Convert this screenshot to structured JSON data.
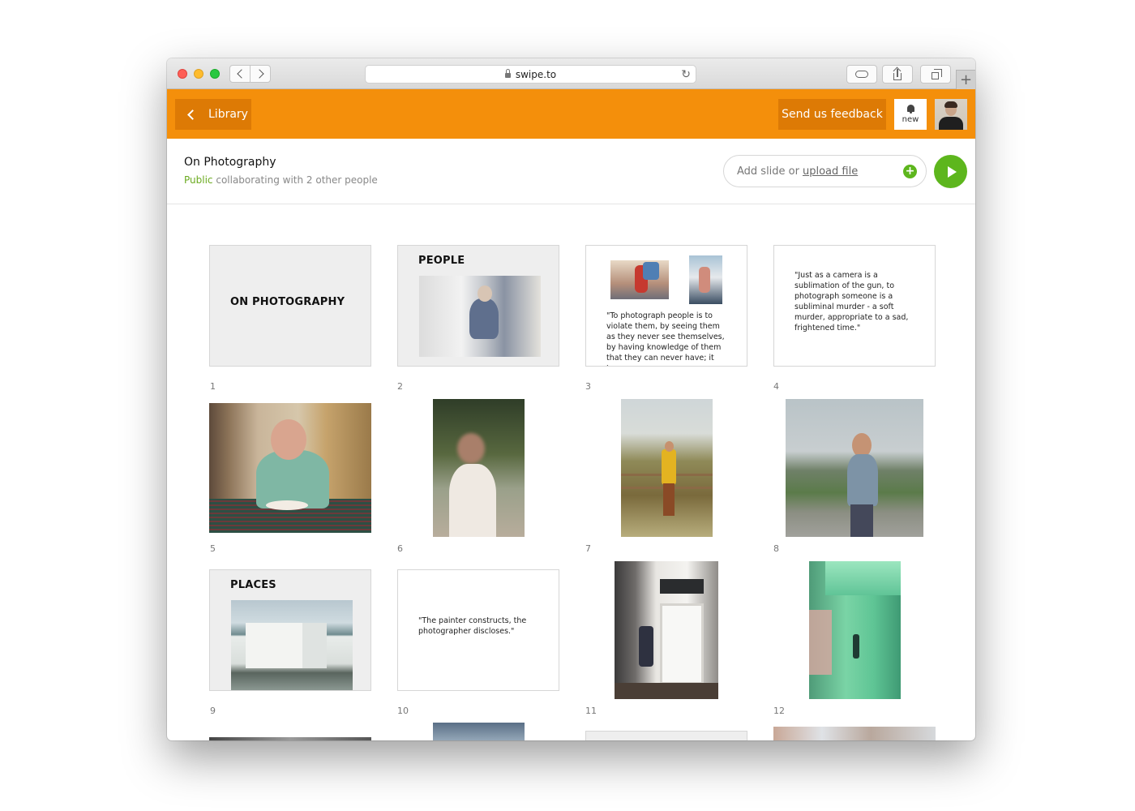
{
  "browser": {
    "url": "swipe.to"
  },
  "header": {
    "back_label": "Library",
    "feedback_label": "Send us feedback",
    "notifications_label": "new"
  },
  "deck": {
    "title": "On Photography",
    "visibility": "Public",
    "collab_text": "collaborating with 2 other people",
    "add_prefix": "Add slide or",
    "add_link": "upload file"
  },
  "slides": [
    {
      "number": "1",
      "title": "ON PHOTOGRAPHY"
    },
    {
      "number": "2",
      "title": "PEOPLE"
    },
    {
      "number": "3",
      "quote": "\"To photograph people is to violate them, by seeing them as they never see themselves, by having knowledge of them that they can never have; it turns"
    },
    {
      "number": "4",
      "quote": "\"Just as a camera is a sublimation of the gun, to photograph someone is a subliminal murder - a soft murder, appropriate to a sad, frightened time.\""
    },
    {
      "number": "5"
    },
    {
      "number": "6"
    },
    {
      "number": "7"
    },
    {
      "number": "8"
    },
    {
      "number": "9",
      "title": "PLACES"
    },
    {
      "number": "10",
      "quote": "\"The painter constructs, the photographer discloses.\""
    },
    {
      "number": "11"
    },
    {
      "number": "12"
    }
  ],
  "colors": {
    "accent": "#f48f0b",
    "accent_dark": "#dd7a05",
    "green": "#5db61d"
  }
}
